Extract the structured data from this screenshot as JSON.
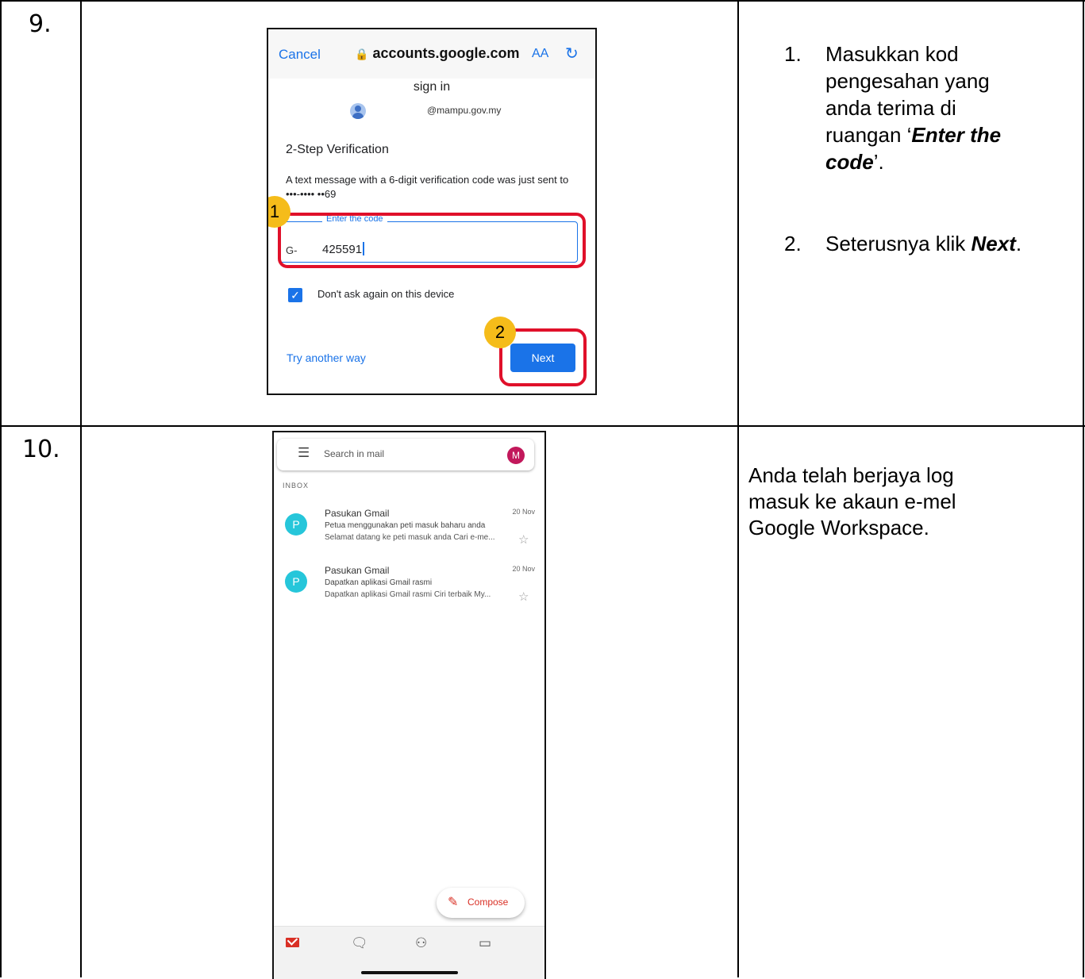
{
  "steps": [
    {
      "number": "9.",
      "screen": {
        "cancel": "Cancel",
        "url": "accounts.google.com",
        "text_size": "AA",
        "subtitle": "sign in",
        "email": "@mampu.gov.my",
        "heading": "2-Step Verification",
        "message": "A text message with a 6-digit verification code was just sent to •••-•••• ••69",
        "field_label": "Enter the code",
        "prefix": "G-",
        "code": "425591",
        "remember": "Don't ask again on this device",
        "remember_checked": true,
        "try_another": "Try another way",
        "next": "Next",
        "badge1": "1",
        "badge2": "2"
      },
      "instructions": [
        {
          "n": "1.",
          "a": "Masukkan kod",
          "b": "pengesahan yang",
          "c": "anda terima di",
          "d_pre": "ruangan ‘",
          "d_em": "Enter the",
          "e_em": "code",
          "e_post": "’."
        },
        {
          "n": "2.",
          "pre": "Seterusnya klik ",
          "em": "Next",
          "post": "."
        }
      ]
    },
    {
      "number": "10.",
      "screen": {
        "search_placeholder": "Search in mail",
        "account_initial": "M",
        "section": "INBOX",
        "emails": [
          {
            "avatar": "P",
            "from": "Pasukan Gmail",
            "date": "20 Nov",
            "subject": "Petua menggunakan peti masuk baharu anda",
            "snippet": "Selamat datang ke peti masuk anda Cari e-me..."
          },
          {
            "avatar": "P",
            "from": "Pasukan Gmail",
            "date": "20 Nov",
            "subject": "Dapatkan aplikasi Gmail rasmi",
            "snippet": "Dapatkan aplikasi Gmail rasmi Ciri terbaik My..."
          }
        ],
        "compose": "Compose"
      },
      "description": [
        "Anda telah berjaya log",
        "masuk ke akaun e-mel",
        "Google Workspace."
      ]
    }
  ],
  "colors": {
    "highlight": "#e0102a",
    "badge": "#f5bc1a",
    "google_blue": "#1a73e8",
    "gmail_red": "#d93025"
  }
}
